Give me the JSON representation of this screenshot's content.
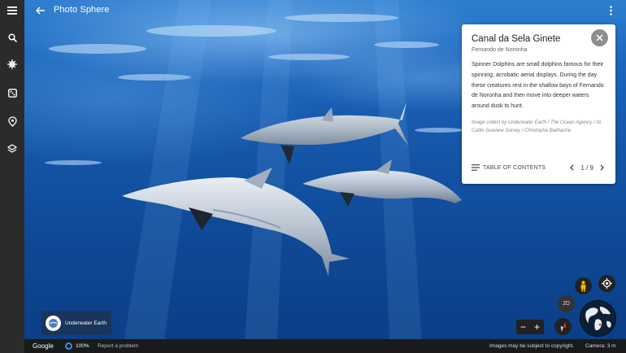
{
  "topbar": {
    "title": "Photo Sphere"
  },
  "rail": {
    "items": [
      {
        "icon": "menu-icon"
      },
      {
        "icon": "search-icon"
      },
      {
        "icon": "voyager-icon"
      },
      {
        "icon": "dice-icon"
      },
      {
        "icon": "projects-icon"
      },
      {
        "icon": "layers-icon"
      }
    ]
  },
  "card": {
    "title": "Canal da Sela Ginete",
    "subtitle": "Fernando de Noronha",
    "body": "Spinner Dolphins are small dolphins famous for their spinning, acrobatic aerial displays. During the day these creatures rest in the shallow bays of Fernando de Noronha and then move into deeper waters around dusk to hunt.",
    "credit": "Image collect by Underwater Earth / The Ocean Agency / XL Catlin Seaview Survey / Christophe Bailhache",
    "toc_label": "TABLE OF CONTENTS",
    "pager": "1 / 9"
  },
  "attribution": {
    "name": "Underwater Earth"
  },
  "controls": {
    "view_2d": "2D",
    "zoom_out": "−",
    "zoom_in": "+"
  },
  "bottombar": {
    "google": "Google",
    "percent": "100%",
    "report": "Report a problem",
    "copyright": "Images may be subject to copyright.",
    "camera": "Camera: 3 m"
  },
  "colors": {
    "rail": "#2b2b2b",
    "water": "#1557aa",
    "accent": "#3b8ee8"
  }
}
